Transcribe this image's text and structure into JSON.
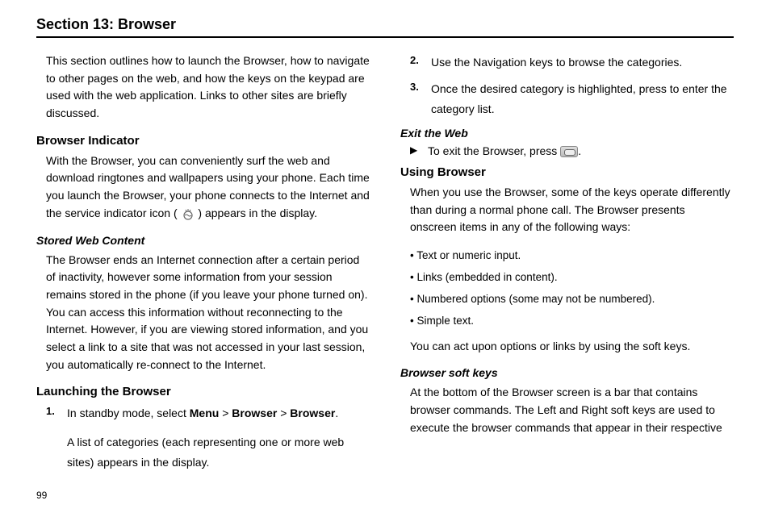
{
  "section_title": "Section 13: Browser",
  "page_number": "99",
  "left": {
    "intro": "This section outlines how to launch the Browser, how to navigate to other pages on the web, and how the keys on the keypad are used with the web application. Links to other sites are briefly discussed.",
    "h_browser_indicator": "Browser Indicator",
    "p_browser_indicator_a": "With the Browser, you can conveniently surf the web and download ringtones and wallpapers using your phone. Each time you launch the Browser, your phone connects to the Internet and the service indicator icon (",
    "p_browser_indicator_b": ") appears in the display.",
    "h_stored": "Stored Web Content",
    "p_stored": "The Browser ends an Internet connection after a certain period of inactivity, however some information from your session remains stored in the phone (if you leave your phone turned on). You can access this information without reconnecting to the Internet. However, if you are viewing stored information, and you select a link to a site that was not accessed in your last session, you automatically re-connect to the Internet.",
    "h_launching": "Launching the Browser",
    "step1_a": "In standby mode, select ",
    "step1_menu": "Menu",
    "step1_gt1": " > ",
    "step1_browser1": "Browser",
    "step1_gt2": " > ",
    "step1_browser2": "Browser",
    "step1_end": ".",
    "step1_sub": "A list of categories (each representing one or more web sites) appears in the display."
  },
  "right": {
    "step2": "Use the Navigation keys to browse the categories.",
    "step3": "Once the desired category is highlighted, press to enter the category list.",
    "h_exit": "Exit the Web",
    "exit_a": "To exit the Browser, press ",
    "exit_b": ".",
    "h_using": "Using Browser",
    "p_using": "When you use the Browser, some of the keys operate differently than during a normal phone call. The Browser presents onscreen items in any of the following ways:",
    "bul1": "• Text or numeric input.",
    "bul2": "• Links (embedded in content).",
    "bul3": "• Numbered options (some may not be numbered).",
    "bul4": "• Simple text.",
    "p_using2": "You can act upon options or links by using the soft keys.",
    "h_soft": "Browser soft keys",
    "p_soft": "At the bottom of the Browser screen is a bar that contains browser commands. The Left and Right soft keys are used to execute the browser commands that appear in their respective"
  }
}
